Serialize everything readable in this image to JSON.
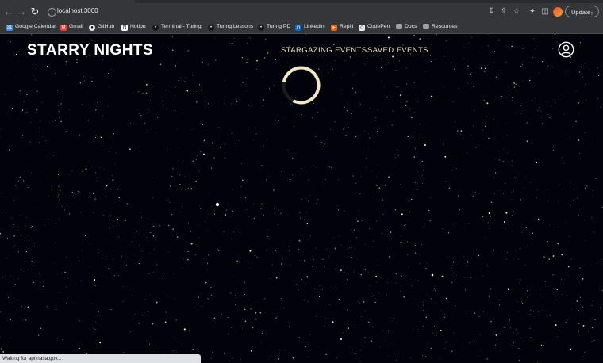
{
  "browser": {
    "url": "localhost:3000",
    "update_label": "Update",
    "bookmarks": [
      {
        "label": "Google Calendar",
        "icon": "calendar-icon",
        "color": "#4285f4"
      },
      {
        "label": "Gmail",
        "icon": "gmail-icon",
        "color": "#ea4335"
      },
      {
        "label": "GitHub",
        "icon": "github-icon",
        "color": "#ffffff"
      },
      {
        "label": "Notion",
        "icon": "notion-icon",
        "color": "#ffffff"
      },
      {
        "label": "Terminal - Turing",
        "icon": "turing-icon",
        "color": "#3c3c3c"
      },
      {
        "label": "Turing Lessons",
        "icon": "turing-icon",
        "color": "#3c3c3c"
      },
      {
        "label": "Turing PD",
        "icon": "turing-icon",
        "color": "#3c3c3c"
      },
      {
        "label": "LinkedIn",
        "icon": "linkedin-icon",
        "color": "#0a66c2"
      },
      {
        "label": "Replit",
        "icon": "replit-icon",
        "color": "#f26207"
      },
      {
        "label": "CodePen",
        "icon": "codepen-icon",
        "color": "#ffffff"
      },
      {
        "label": "Docs",
        "icon": "folder-icon",
        "color": "#9aa0a6"
      },
      {
        "label": "Resources",
        "icon": "folder-icon",
        "color": "#9aa0a6"
      }
    ],
    "status_text": "Waiting for api.nasa.gov..."
  },
  "app": {
    "brand": "STARRY NIGHTS",
    "nav": {
      "events": "STARGAZING EVENTS",
      "saved": "SAVED EVENTS"
    },
    "accent_color": "#f3e6c4",
    "loading": true
  }
}
